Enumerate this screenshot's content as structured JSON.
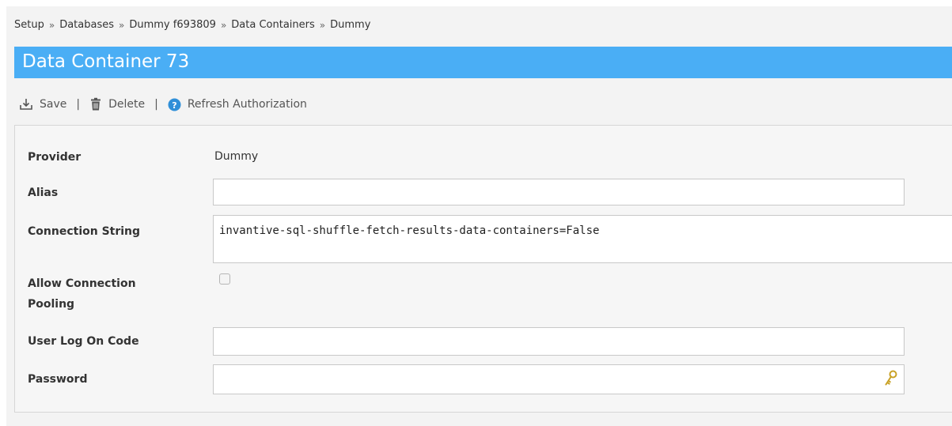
{
  "breadcrumb": {
    "items": [
      "Setup",
      "Databases",
      "Dummy f693809",
      "Data Containers",
      "Dummy"
    ],
    "separator": "»"
  },
  "page": {
    "title": "Data Container 73"
  },
  "toolbar": {
    "save_label": "Save",
    "delete_label": "Delete",
    "refresh_label": "Refresh Authorization",
    "separator": "|"
  },
  "form": {
    "provider": {
      "label": "Provider",
      "value": "Dummy"
    },
    "alias": {
      "label": "Alias",
      "value": ""
    },
    "connection_string": {
      "label": "Connection String",
      "value": "invantive-sql-shuffle-fetch-results-data-containers=False"
    },
    "allow_pooling": {
      "label_line1": "Allow Connection",
      "label_line2": "Pooling",
      "checked": false
    },
    "user_log_on_code": {
      "label": "User Log On Code",
      "value": ""
    },
    "password": {
      "label": "Password",
      "value": ""
    }
  },
  "colors": {
    "title_bar": "#4aaef5",
    "help_icon": "#2f8fd8",
    "key_icon": "#c9a227"
  },
  "icons": {
    "save": "download-tray-icon",
    "delete": "trash-icon",
    "refresh": "help-circle-icon",
    "password": "key-icon"
  }
}
